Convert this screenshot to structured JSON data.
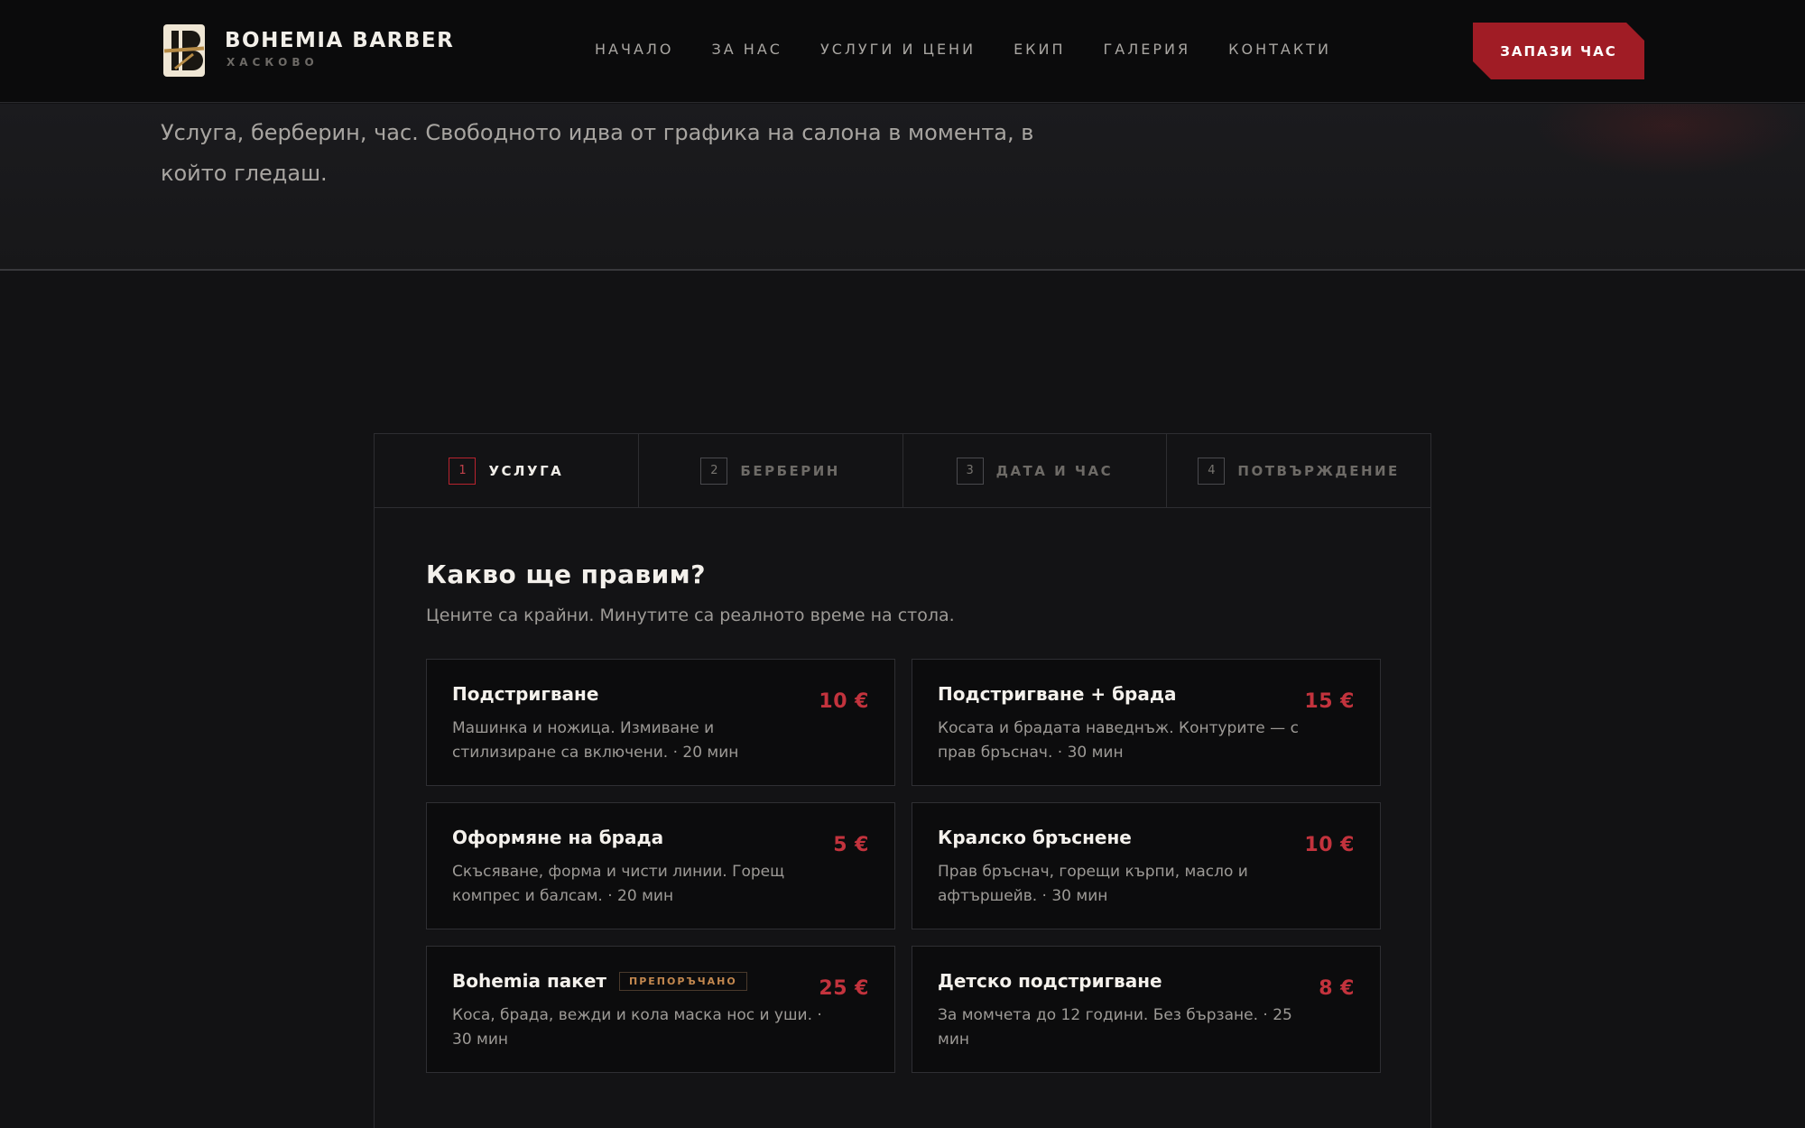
{
  "brand": {
    "name": "BOHEMIA BARBER",
    "city": "ХАСКОВО"
  },
  "nav": [
    {
      "label": "НАЧАЛО",
      "name": "nav-home"
    },
    {
      "label": "ЗА НАС",
      "name": "nav-about"
    },
    {
      "label": "УСЛУГИ И ЦЕНИ",
      "name": "nav-services"
    },
    {
      "label": "ЕКИП",
      "name": "nav-team"
    },
    {
      "label": "ГАЛЕРИЯ",
      "name": "nav-gallery"
    },
    {
      "label": "КОНТАКТИ",
      "name": "nav-contacts"
    }
  ],
  "header": {
    "book_label": "ЗАПАЗИ ЧАС"
  },
  "hero": {
    "text": "Услуга, берберин, час. Свободното идва от графика на салона в момента, в който гледаш."
  },
  "steps": [
    {
      "num": "1",
      "label": "УСЛУГА",
      "active": true
    },
    {
      "num": "2",
      "label": "БЕРБЕРИН",
      "active": false
    },
    {
      "num": "3",
      "label": "ДАТА И ЧАС",
      "active": false
    },
    {
      "num": "4",
      "label": "ПОТВЪРЖДЕНИЕ",
      "active": false
    }
  ],
  "question": {
    "title": "Какво ще правим?",
    "subtitle": "Цените са крайни. Минутите са реалното време на стола."
  },
  "services": [
    {
      "name": "Подстригване",
      "desc": "Машинка и ножица. Измиване и стилизиране са включени. · 20 мин",
      "price": "10 €",
      "badge": ""
    },
    {
      "name": "Подстригване + брада",
      "desc": "Косата и брадата наведнъж. Контурите — с прав бръснач. · 30 мин",
      "price": "15 €",
      "badge": ""
    },
    {
      "name": "Оформяне на брада",
      "desc": "Скъсяване, форма и чисти линии. Горещ компрес и балсам. · 20 мин",
      "price": "5 €",
      "badge": ""
    },
    {
      "name": "Кралско бръснене",
      "desc": "Прав бръснач, горещи кърпи, масло и афтършейв. · 30 мин",
      "price": "10 €",
      "badge": ""
    },
    {
      "name": "Bohemia пакет",
      "desc": "Коса, брада, вежди и кола маска нос и уши. · 30 мин",
      "price": "25 €",
      "badge": "ПРЕПОРЪЧАНО"
    },
    {
      "name": "Детско подстригване",
      "desc": "За момчета до 12 години. Без бързане. · 25 мин",
      "price": "8 €",
      "badge": ""
    }
  ],
  "colors": {
    "accent": "#a01c25",
    "price": "#c3333d",
    "badge": "#c3884f"
  }
}
